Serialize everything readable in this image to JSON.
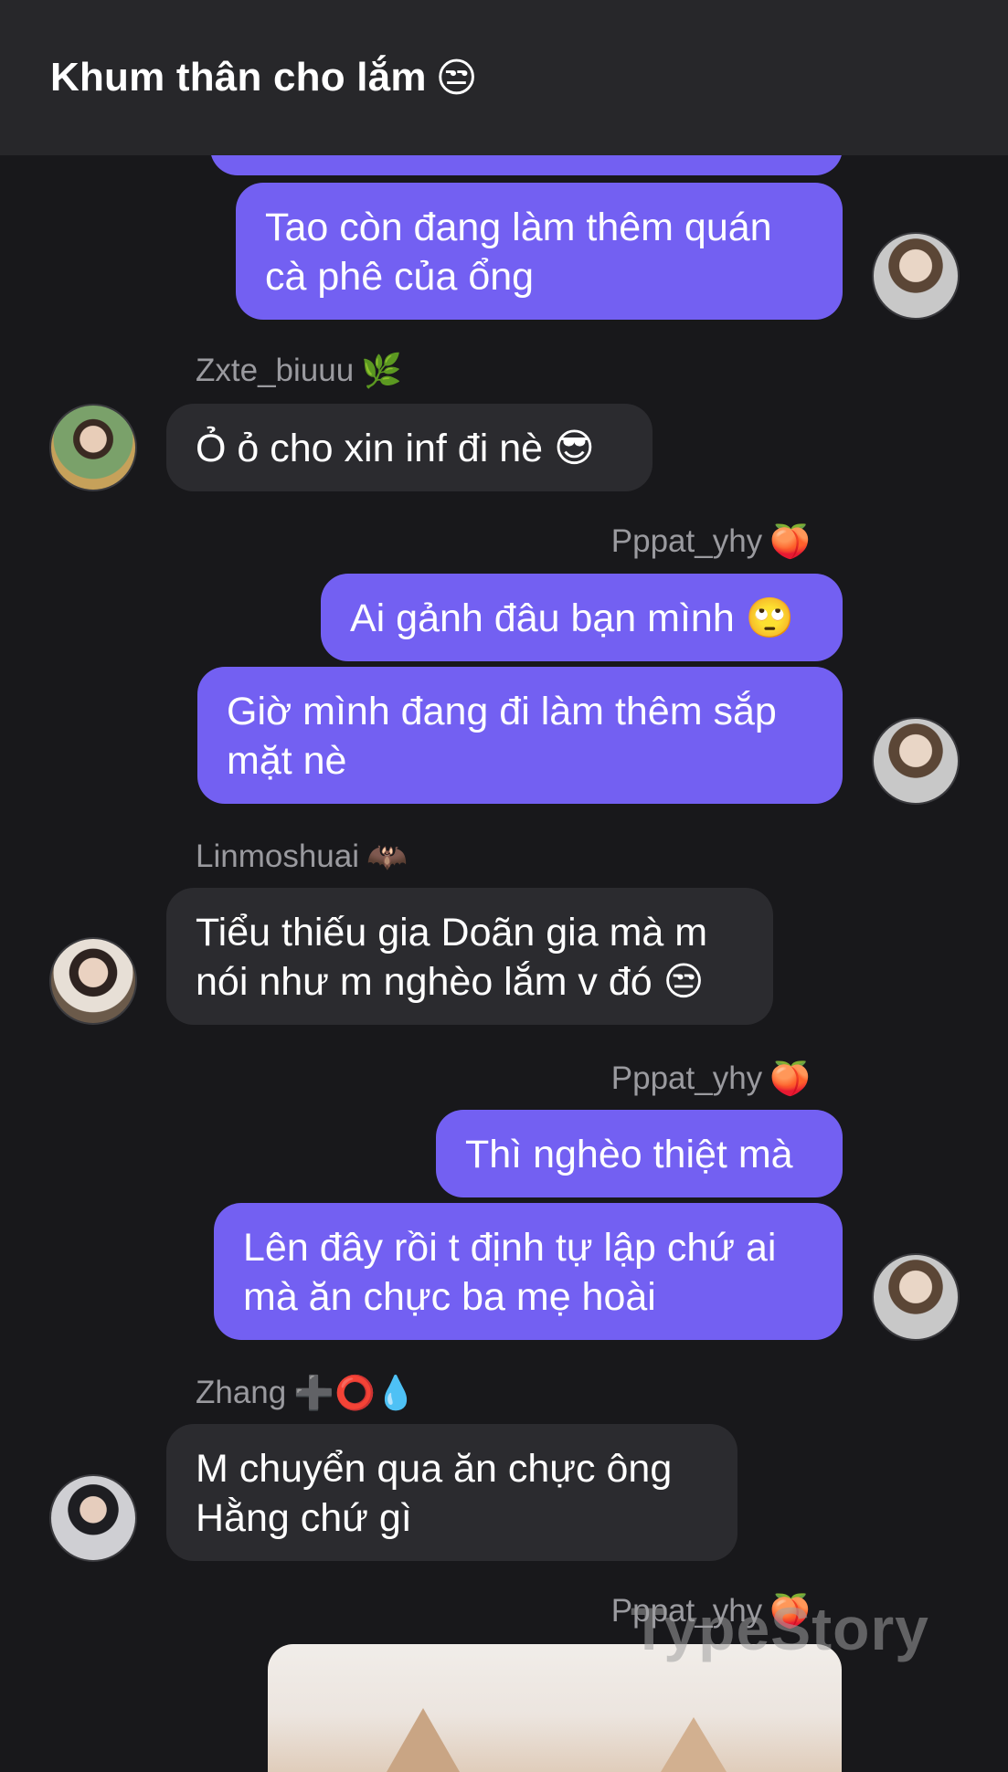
{
  "header": {
    "title": "Khum thân cho lắm",
    "emoji": "😒"
  },
  "messages": {
    "m1": "Tao còn đang làm thêm quán cà phê của ổng",
    "s2": {
      "name": "Zxte_biuuu",
      "emoji": "🌿"
    },
    "m2": "Ỏ ỏ cho xin inf đi nè 😎",
    "s3": {
      "name": "Pppat_yhy",
      "emoji": "🍑"
    },
    "m3a": "Ai gảnh đâu bạn mình 🙄",
    "m3b": "Giờ mình đang đi làm thêm sắp mặt nè",
    "s4": {
      "name": "Linmoshuai",
      "emoji": "🦇"
    },
    "m4": "Tiểu thiếu gia Doãn gia mà m nói như m nghèo lắm v đó 😒",
    "s5": {
      "name": "Pppat_yhy",
      "emoji": "🍑"
    },
    "m5a": "Thì nghèo thiệt mà",
    "m5b": "Lên đây rồi t định tự lập chứ ai mà ăn chực ba mẹ hoài",
    "s6": {
      "name": "Zhang",
      "emoji": "➕⭕💧"
    },
    "m6": "M chuyển qua ăn chực ông Hằng chứ gì",
    "s7": {
      "name": "Pppat_yhy",
      "emoji": "🍑"
    }
  },
  "watermark": "TypeStory"
}
